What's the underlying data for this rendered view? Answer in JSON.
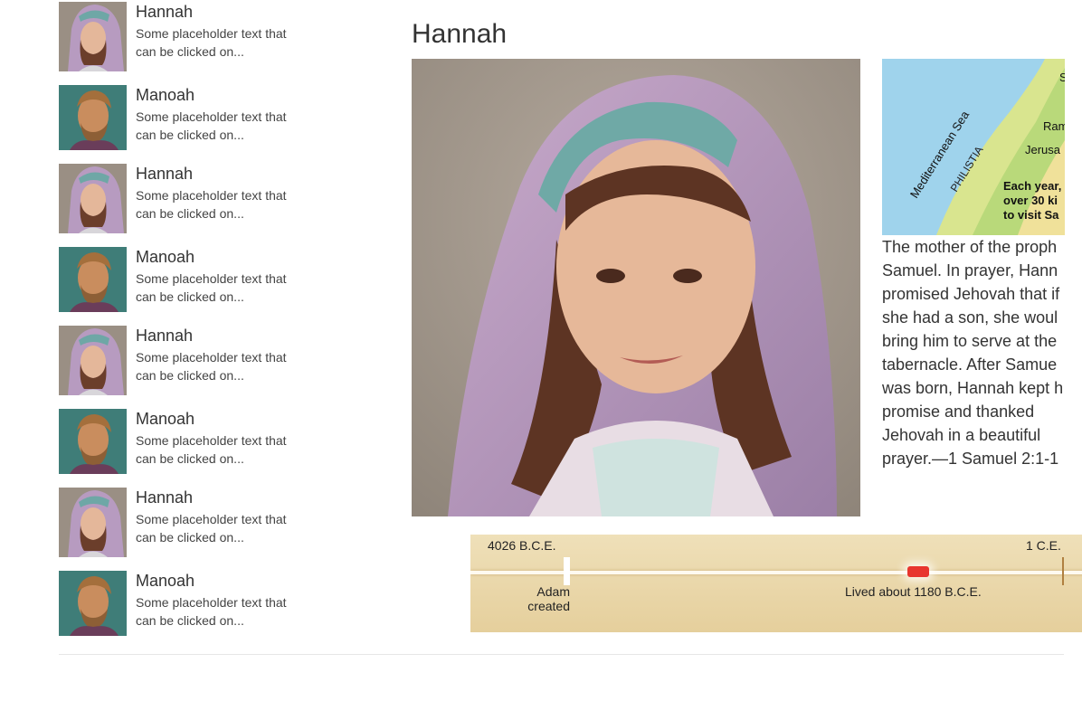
{
  "sidebar": {
    "items": [
      {
        "title": "Hannah",
        "text": "Some placeholder text that can be clicked on...",
        "avatar": "hannah"
      },
      {
        "title": "Manoah",
        "text": "Some placeholder text that can be clicked on...",
        "avatar": "manoah"
      },
      {
        "title": "Hannah",
        "text": "Some placeholder text that can be clicked on...",
        "avatar": "hannah"
      },
      {
        "title": "Manoah",
        "text": "Some placeholder text that can be clicked on...",
        "avatar": "manoah"
      },
      {
        "title": "Hannah",
        "text": "Some placeholder text that can be clicked on...",
        "avatar": "hannah"
      },
      {
        "title": "Manoah",
        "text": "Some placeholder text that can be clicked on...",
        "avatar": "manoah"
      },
      {
        "title": "Hannah",
        "text": "Some placeholder text that can be clicked on...",
        "avatar": "hannah"
      },
      {
        "title": "Manoah",
        "text": "Some placeholder text that can be clicked on...",
        "avatar": "manoah"
      }
    ]
  },
  "main": {
    "title": "Hannah",
    "map": {
      "sea_label": "Mediterranean Sea",
      "region_label": "PHILISTIA",
      "city_1": "Ram",
      "city_2": "Jerusa",
      "city_top": "S",
      "note_line_1": "Each year,",
      "note_line_2": "over 30 ki",
      "note_line_3": "to visit Sa"
    },
    "bio_lines": [
      "The mother of the proph",
      "Samuel. In prayer, Hann",
      "promised Jehovah that if",
      "she had a son, she woul",
      "bring him to serve at the",
      "tabernacle. After Samue",
      "was born, Hannah kept h",
      "promise and thanked",
      "Jehovah in a beautiful",
      "prayer.—1 Samuel 2:1-1"
    ],
    "timeline": {
      "start_label": "4026 B.C.E.",
      "end_label": "1 C.E.",
      "adam_line_1": "Adam",
      "adam_line_2": "created",
      "lived_label": "Lived about 1180 B.C.E."
    }
  },
  "colors": {
    "hannah_scarf": "#b79bc0",
    "hannah_headband": "#6ea7a6",
    "manoah_bg": "#3f7d78",
    "timeline_bg": "#ecdcb2",
    "timeline_marker": "#e8352e"
  }
}
